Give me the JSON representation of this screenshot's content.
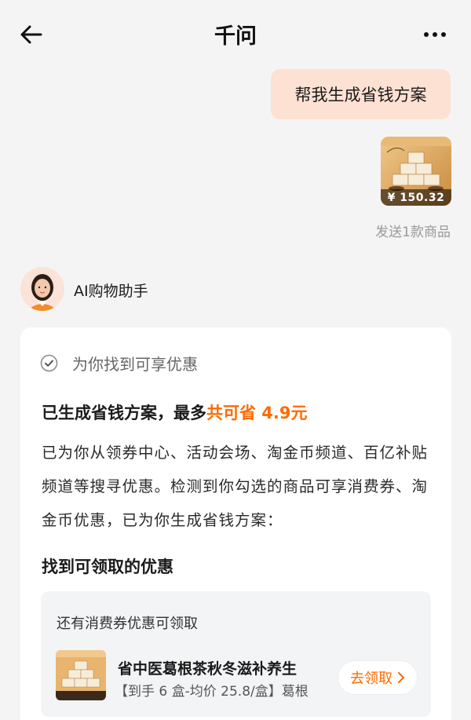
{
  "header": {
    "title": "千问"
  },
  "user_message": {
    "text": "帮我生成省钱方案",
    "product_price": "¥ 150.32",
    "sent_note": "发送1款商品"
  },
  "assistant": {
    "name": "AI购物助手",
    "status": "为你找到可享优惠",
    "plan_title_prefix": "已生成省钱方案，最多",
    "plan_title_highlight": "共可省 4.9元",
    "plan_body": "已为你从领券中心、活动会场、淘金币频道、百亿补贴频道等搜寻优惠。检测到你勾选的商品可享消费券、淘金币优惠，已为你生成省钱方案：",
    "found_title": "找到可领取的优惠",
    "coupon": {
      "hint": "还有消费券优惠可领取",
      "product_name": "省中医葛根茶秋冬滋补养生",
      "product_sub": "【到手 6 盒-均价 25.8/盒】葛根",
      "claim_label": "去领取"
    }
  },
  "colors": {
    "accent": "#ff6a00",
    "user_bubble": "#fde1d2",
    "background": "#f4f4f5"
  },
  "icons": [
    "back-arrow-icon",
    "more-dots-icon",
    "check-circle-icon",
    "chevron-right-icon"
  ]
}
